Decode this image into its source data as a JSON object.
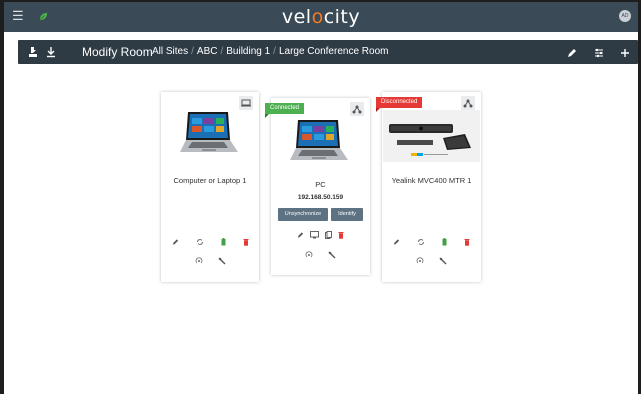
{
  "brand": {
    "pre": "vel",
    "accent": "o",
    "post": "city"
  },
  "user": {
    "initials": "AD"
  },
  "subbar": {
    "title": "Modify Room",
    "breadcrumb": [
      "All Sites",
      "ABC",
      "Building 1",
      "Large Conference Room"
    ]
  },
  "devices": [
    {
      "name": "Computer or Laptop 1",
      "status": ""
    },
    {
      "name": "PC",
      "status": "Connected",
      "ip": "192.168.50.159",
      "btn_unsync": "Unsynchronize",
      "btn_identify": "Identify"
    },
    {
      "name": "Yealink MVC400 MTR 1",
      "status": "Disconnected"
    }
  ],
  "colors": {
    "topbar": "#3a4a57",
    "subbar": "#2e3b45",
    "connected": "#4caf50",
    "disconnected": "#e53935",
    "accent": "#f47b20"
  }
}
